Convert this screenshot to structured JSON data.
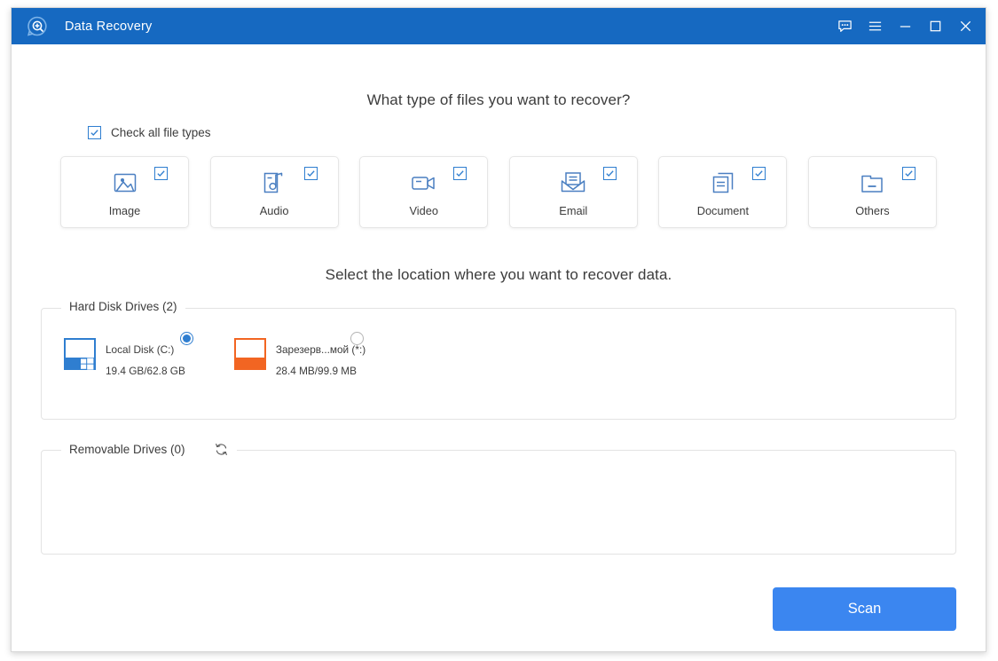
{
  "window": {
    "title": "Data Recovery",
    "logo_icon": "magnifier-plus-bubble-icon",
    "controls": [
      {
        "name": "feedback-button",
        "icon": "chat-bubble-icon"
      },
      {
        "name": "menu-button",
        "icon": "hamburger-menu-icon"
      },
      {
        "name": "minimize-button",
        "icon": "minimize-icon"
      },
      {
        "name": "maximize-button",
        "icon": "maximize-icon"
      },
      {
        "name": "close-button",
        "icon": "close-icon"
      }
    ],
    "titlebar_color": "#1669c1"
  },
  "headings": {
    "file_types": "What type of files you want to recover?",
    "location": "Select the location where you want to recover data."
  },
  "check_all": {
    "label": "Check all file types",
    "checked": true
  },
  "file_types": [
    {
      "label": "Image",
      "icon": "image-icon",
      "checked": true
    },
    {
      "label": "Audio",
      "icon": "audio-icon",
      "checked": true
    },
    {
      "label": "Video",
      "icon": "video-icon",
      "checked": true
    },
    {
      "label": "Email",
      "icon": "email-icon",
      "checked": true
    },
    {
      "label": "Document",
      "icon": "document-icon",
      "checked": true
    },
    {
      "label": "Others",
      "icon": "folder-icon",
      "checked": true
    }
  ],
  "hard_disk_drives": {
    "legend": "Hard Disk Drives (2)",
    "drives": [
      {
        "name": "Local Disk (C:)",
        "size": "19.4 GB/62.8 GB",
        "icon": "windows-drive-icon",
        "selected": true,
        "bar_color": "#2f7ed0"
      },
      {
        "name": "Зарезерв...мой (*:)",
        "size": "28.4 MB/99.9 MB",
        "icon": "drive-icon",
        "selected": false,
        "bar_color": "#f26522"
      }
    ]
  },
  "removable_drives": {
    "legend": "Removable Drives (0)",
    "refresh_icon": "refresh-icon",
    "drives": []
  },
  "footer": {
    "scan_label": "Scan",
    "scan_color": "#3b86f0"
  }
}
